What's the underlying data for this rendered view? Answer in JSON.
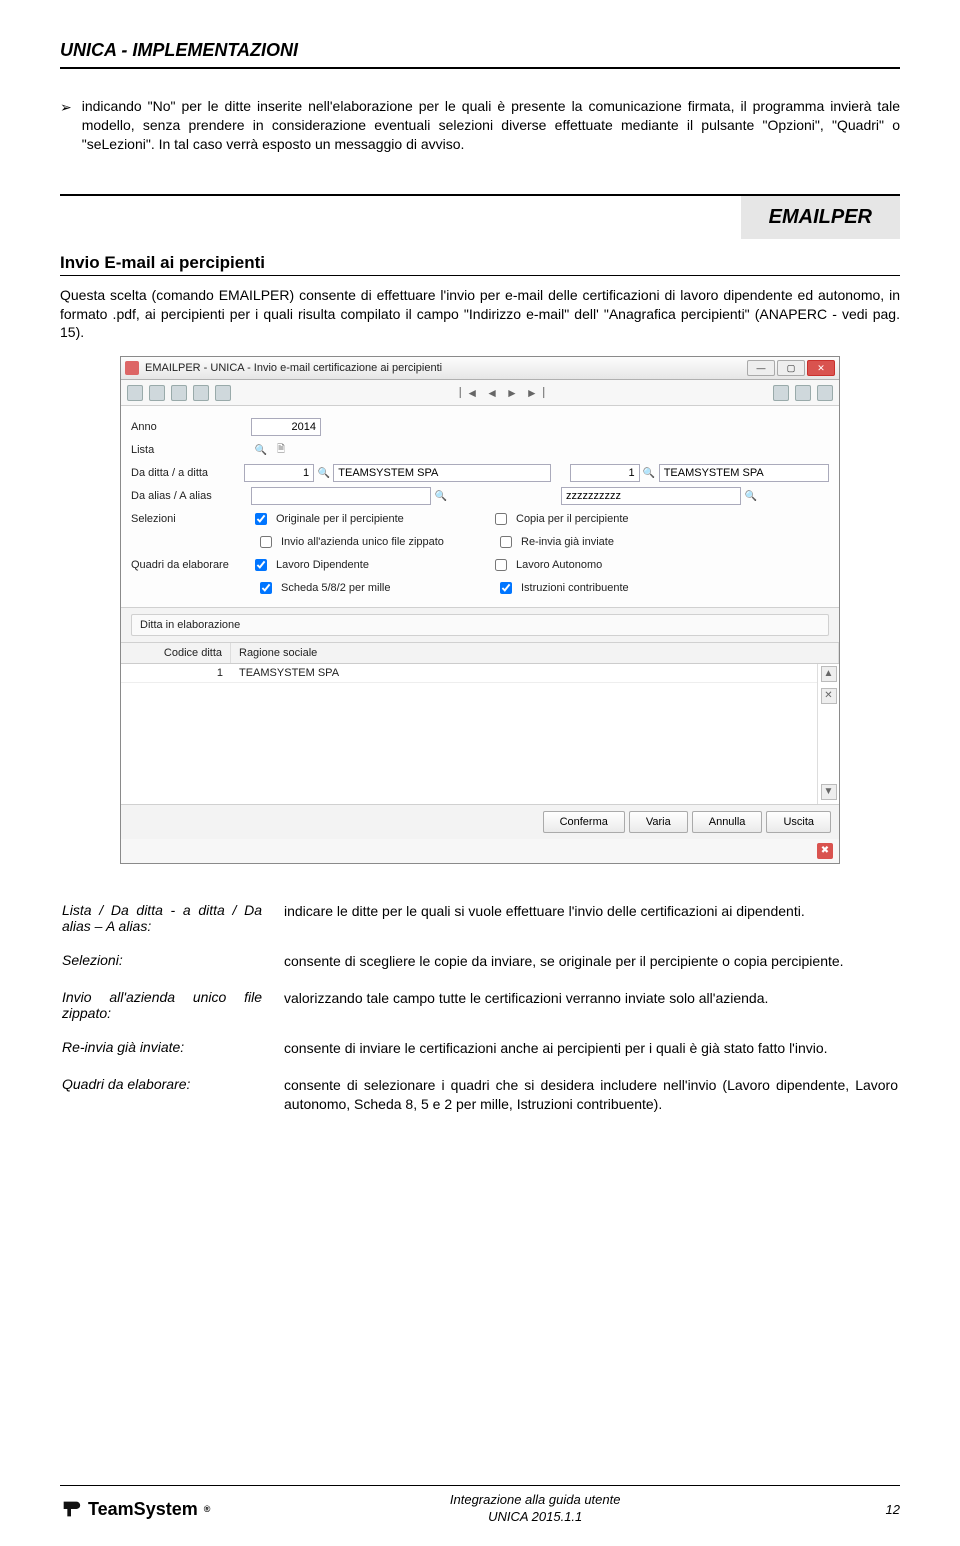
{
  "doc": {
    "title": "UNICA - IMPLEMENTAZIONI",
    "intro_bullet": "indicando \"No\" per le ditte inserite nell'elaborazione per le quali è presente la comunicazione firmata, il programma invierà tale modello, senza prendere in considerazione eventuali selezioni diverse effettuate mediante il pulsante \"Opzioni\", \"Quadri\" o \"seLezioni\". In tal caso verrà esposto un messaggio di avviso.",
    "section_badge": "EMAILPER",
    "sub_heading": "Invio E-mail ai percipienti",
    "section_body": "Questa scelta (comando EMAILPER) consente di effettuare l'invio per e-mail delle certificazioni di lavoro dipendente ed autonomo, in formato .pdf, ai percipienti per i quali risulta compilato il campo \"Indirizzo e-mail\" dell' \"Anagrafica percipienti\" (ANAPERC - vedi pag. 15)."
  },
  "screenshot": {
    "window_title": "EMAILPER - UNICA - Invio e-mail certificazione ai percipienti",
    "labels": {
      "anno": "Anno",
      "lista": "Lista",
      "da_ditta": "Da ditta / a ditta",
      "da_alias": "Da alias / A alias",
      "selezioni": "Selezioni",
      "quadri": "Quadri da elaborare",
      "ditta_elab": "Ditta in elaborazione"
    },
    "values": {
      "anno": "2014",
      "ditta_from_code": "1",
      "ditta_from_name": "TEAMSYSTEM SPA",
      "ditta_to_code": "1",
      "ditta_to_name": "TEAMSYSTEM SPA",
      "alias_to": "zzzzzzzzzz"
    },
    "checkboxes": {
      "originale": {
        "label": "Originale per il percipiente",
        "checked": true
      },
      "copia": {
        "label": "Copia per il percipiente",
        "checked": false
      },
      "invio_zip": {
        "label": "Invio all'azienda unico file zippato",
        "checked": false
      },
      "reinvia": {
        "label": "Re-invia già inviate",
        "checked": false
      },
      "lav_dip": {
        "label": "Lavoro Dipendente",
        "checked": true
      },
      "lav_aut": {
        "label": "Lavoro Autonomo",
        "checked": false
      },
      "scheda": {
        "label": "Scheda 5/8/2 per mille",
        "checked": true
      },
      "istruz": {
        "label": "Istruzioni contribuente",
        "checked": true
      }
    },
    "table": {
      "col1": "Codice ditta",
      "col2": "Ragione sociale",
      "rows": [
        {
          "codice": "1",
          "ragione": "TEAMSYSTEM SPA"
        }
      ]
    },
    "buttons": {
      "conferma": "Conferma",
      "varia": "Varia",
      "annulla": "Annulla",
      "uscita": "Uscita"
    }
  },
  "definitions": [
    {
      "term": "Lista /\nDa ditta - a ditta /\nDa alias – A alias:",
      "desc": "indicare le ditte per le quali si vuole effettuare l'invio delle certificazioni ai dipendenti."
    },
    {
      "term": "Selezioni:",
      "desc": "consente di scegliere le copie da inviare, se originale per il percipiente o copia percipiente."
    },
    {
      "term": "Invio all'azienda unico file zippato:",
      "desc": "valorizzando tale campo tutte le certificazioni verranno inviate solo all'azienda."
    },
    {
      "term": "Re-invia già inviate:",
      "desc": "consente di inviare le certificazioni anche ai percipienti per i quali è già stato fatto l'invio."
    },
    {
      "term": "Quadri da elaborare:",
      "desc": "consente di selezionare i quadri che si desidera includere nell'invio (Lavoro dipendente, Lavoro autonomo, Scheda 8, 5 e 2 per mille, Istruzioni contribuente)."
    }
  ],
  "footer": {
    "logo_text": "TeamSystem",
    "center_line1": "Integrazione alla guida utente",
    "center_line2": "UNICA 2015.1.1",
    "page": "12"
  }
}
